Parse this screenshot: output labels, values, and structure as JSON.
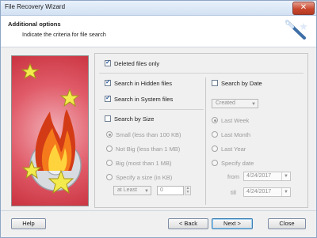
{
  "window": {
    "title": "File Recovery Wizard",
    "close_glyph": "✕"
  },
  "header": {
    "title": "Additional options",
    "subtitle": "Indicate the criteria for file search",
    "icon": "magic-wand-icon"
  },
  "options": {
    "deleted_only": "Deleted files only",
    "hidden": "Search in Hidden files",
    "system": "Search in System files",
    "by_size": {
      "label": "Search by Size",
      "choices": [
        "Small (less than 100 KB)",
        "Not Big (less than 1 MB)",
        "Big (most than 1 MB)",
        "Specify a size (in KB)"
      ],
      "qualifier": "at Least",
      "value": "0"
    },
    "by_date": {
      "label": "Search by Date",
      "type": "Created",
      "choices": [
        "Last Week",
        "Last Month",
        "Last Year",
        "Specify date"
      ],
      "from_label": "from",
      "till_label": "till",
      "from": "4/24/2017",
      "till": "4/24/2017"
    }
  },
  "buttons": {
    "help": "Help",
    "back": "< Back",
    "next": "Next >",
    "close": "Close"
  },
  "colors": {
    "image_panel": "#d84a58",
    "accent": "#3c7fb1"
  }
}
